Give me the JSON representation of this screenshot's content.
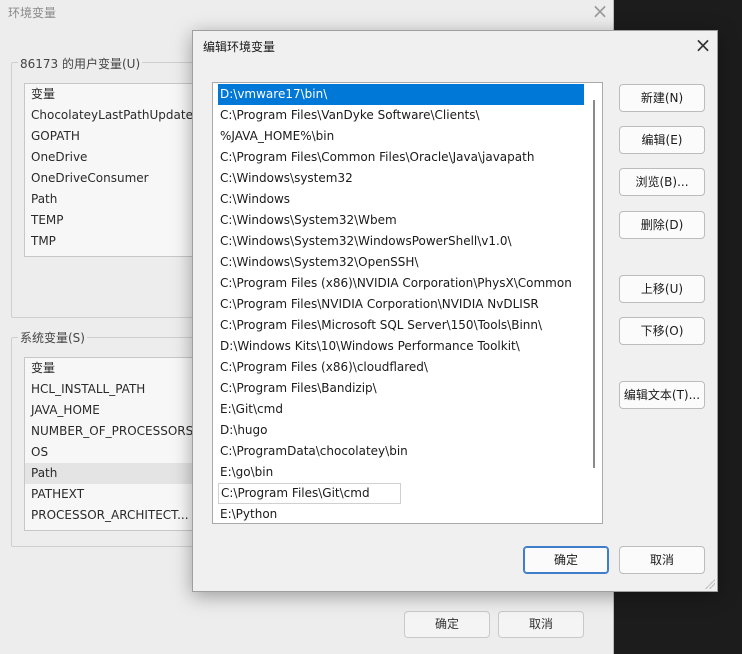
{
  "background_dialog": {
    "title": "环境变量",
    "user_group_title": "86173 的用户变量(U)",
    "user_list_header": "变量",
    "user_vars": [
      "ChocolateyLastPathUpdate",
      "GOPATH",
      "OneDrive",
      "OneDriveConsumer",
      "Path",
      "TEMP",
      "TMP"
    ],
    "system_group_title": "系统变量(S)",
    "system_list_header": "变量",
    "system_vars": [
      "HCL_INSTALL_PATH",
      "JAVA_HOME",
      "NUMBER_OF_PROCESSORS",
      "OS",
      "Path",
      "PATHEXT",
      "PROCESSOR_ARCHITECT..."
    ],
    "system_selected": "Path",
    "ok_label": "确定",
    "cancel_label": "取消"
  },
  "dialog": {
    "title": "编辑环境变量",
    "paths": [
      "D:\\vmware17\\bin\\",
      "C:\\Program Files\\VanDyke Software\\Clients\\",
      "%JAVA_HOME%\\bin",
      "C:\\Program Files\\Common Files\\Oracle\\Java\\javapath",
      "C:\\Windows\\system32",
      "C:\\Windows",
      "C:\\Windows\\System32\\Wbem",
      "C:\\Windows\\System32\\WindowsPowerShell\\v1.0\\",
      "C:\\Windows\\System32\\OpenSSH\\",
      "C:\\Program Files (x86)\\NVIDIA Corporation\\PhysX\\Common",
      "C:\\Program Files\\NVIDIA Corporation\\NVIDIA NvDLISR",
      "C:\\Program Files\\Microsoft SQL Server\\150\\Tools\\Binn\\",
      "D:\\Windows Kits\\10\\Windows Performance Toolkit\\",
      "C:\\Program Files (x86)\\cloudflared\\",
      "C:\\Program Files\\Bandizip\\",
      "E:\\Git\\cmd",
      "D:\\hugo",
      "C:\\ProgramData\\chocolatey\\bin",
      "E:\\go\\bin",
      "C:\\Program Files\\Git\\cmd",
      "E:\\Python"
    ],
    "selected_index": 0,
    "editing_index": 19,
    "buttons": {
      "new": "新建(N)",
      "edit": "编辑(E)",
      "browse": "浏览(B)...",
      "delete": "删除(D)",
      "move_up": "上移(U)",
      "move_down": "下移(O)",
      "edit_text": "编辑文本(T)..."
    },
    "ok_label": "确定",
    "cancel_label": "取消"
  },
  "colors": {
    "selection": "#0078d7",
    "ok_border": "#3f7cc9"
  }
}
